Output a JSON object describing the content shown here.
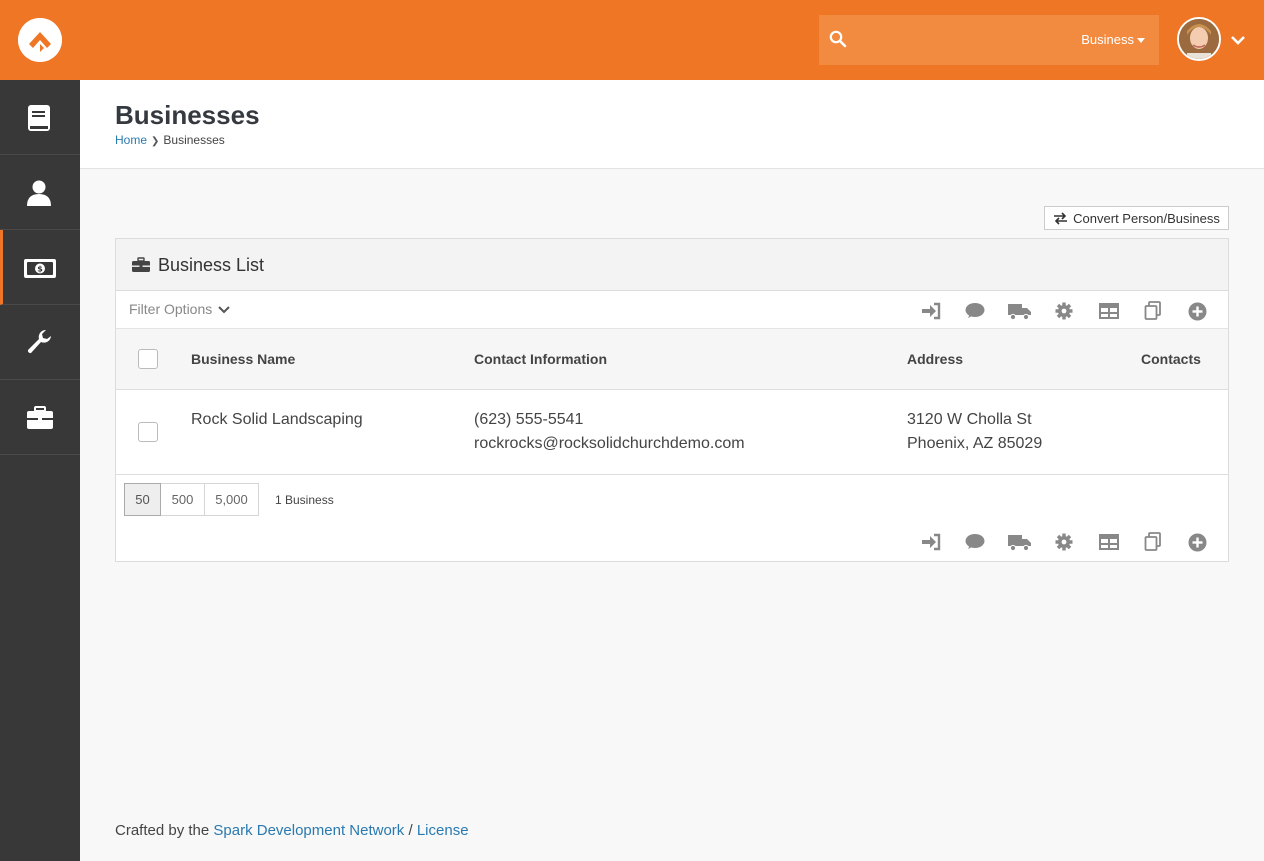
{
  "colors": {
    "brand": "#ee7625",
    "sidebar": "#383838",
    "link": "#2a7ab0"
  },
  "header": {
    "logo_icon": "rock-logo-icon",
    "search": {
      "value": "",
      "placeholder": "",
      "scope_label": "Business"
    },
    "avatar_icon": "user-avatar"
  },
  "sidebar": {
    "items": [
      {
        "icon": "book-icon",
        "active": false
      },
      {
        "icon": "user-icon",
        "active": false
      },
      {
        "icon": "money-icon",
        "active": true
      },
      {
        "icon": "wrench-icon",
        "active": false
      },
      {
        "icon": "briefcase-icon",
        "active": false
      }
    ]
  },
  "page": {
    "title": "Businesses",
    "breadcrumb": {
      "home": "Home",
      "current": "Businesses"
    }
  },
  "convert_button": {
    "label": "Convert Person/Business",
    "icon": "exchange-icon"
  },
  "panel": {
    "title": "Business List",
    "icon": "briefcase-icon",
    "filter_label": "Filter Options",
    "actions": [
      "merge-icon",
      "communicate-icon",
      "truck-icon",
      "gear-icon",
      "grid-icon",
      "copy-icon",
      "add-icon"
    ],
    "columns": [
      "Business Name",
      "Contact Information",
      "Address",
      "Contacts"
    ],
    "rows": [
      {
        "name": "Rock Solid Landscaping",
        "phone": "(623) 555-5541",
        "email": "rockrocks@rocksolidchurchdemo.com",
        "address1": "3120 W Cholla St",
        "address2": "Phoenix, AZ 85029",
        "contacts": ""
      }
    ],
    "page_sizes": [
      "50",
      "500",
      "5,000"
    ],
    "active_page_size": "50",
    "item_count": "1 Business"
  },
  "footer": {
    "prefix": "Crafted by the ",
    "link1": "Spark Development Network",
    "separator": " / ",
    "link2": "License"
  }
}
